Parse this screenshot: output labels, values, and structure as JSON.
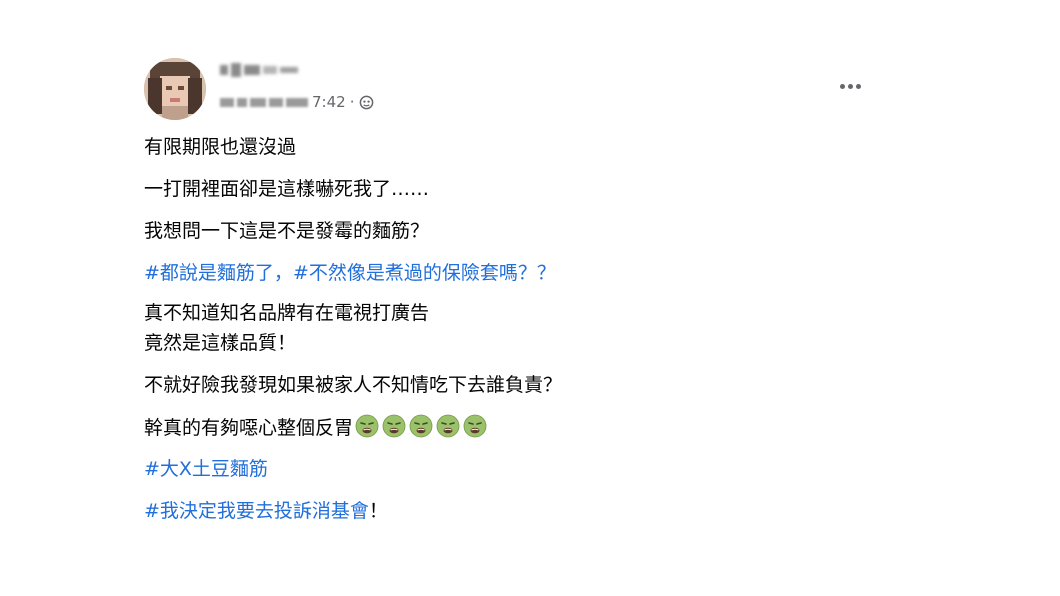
{
  "post": {
    "timestamp_visible": "7:42",
    "separator": "·",
    "privacy_icon": "public-globe-icon",
    "more_icon": "more-options-icon",
    "lines": {
      "l1": "有限期限也還沒過",
      "l2": "一打開裡面卻是這樣嚇死我了……",
      "l3": "我想問一下這是不是發霉的麵筋？",
      "l4_tag1": "#都說是麵筋了，",
      "l4_tag2": "#不然像是煮過的保險套嗎",
      "l4_tail": "？？",
      "l5": "真不知道知名品牌有在電視打廣告",
      "l6": "竟然是這樣品質！",
      "l7": "不就好險我發現如果被家人不知情吃下去誰負責？",
      "l8": "幹真的有夠噁心整個反胃",
      "l8_emoji": "nauseated-face-icon",
      "l9_tag": "#大X土豆麵筋",
      "l10_tag": "#我決定我要去投訴消基會",
      "l10_tail": "！"
    },
    "colors": {
      "text": "#050505",
      "hashtag": "#216fdb",
      "meta": "#65676b",
      "emoji_face": "#9bc16b"
    }
  }
}
